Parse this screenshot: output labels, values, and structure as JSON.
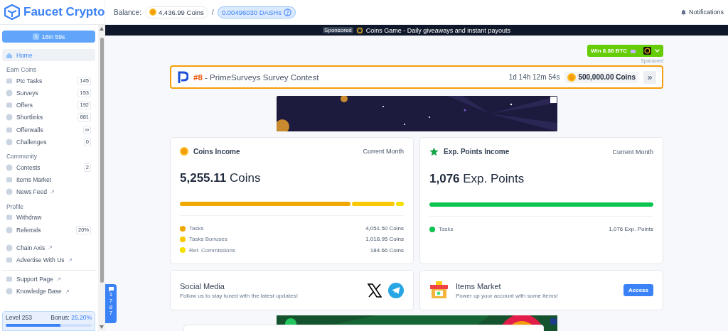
{
  "brand": {
    "name": "Faucet Crypto"
  },
  "header": {
    "balance_label": "Balance:",
    "coins": "4,436.99 Coins",
    "separator": "/",
    "dash": "0.00496030 DASHs",
    "notifications": "Notifications"
  },
  "sidebar": {
    "timer": "18m 59s",
    "sections": [
      {
        "items": [
          {
            "label": "Home",
            "selected": true,
            "external": false
          }
        ]
      },
      {
        "title": "Earn Coins",
        "items": [
          {
            "label": "Ptc Tasks",
            "badge": "145",
            "selected": false,
            "external": false
          },
          {
            "label": "Surveys",
            "badge": "153",
            "selected": false,
            "external": false
          },
          {
            "label": "Offers",
            "badge": "192",
            "selected": false,
            "external": false
          },
          {
            "label": "Shortlinks",
            "badge": "881",
            "selected": false,
            "external": false
          },
          {
            "label": "Offerwalls",
            "badge": "∞",
            "selected": false,
            "external": false
          },
          {
            "label": "Challenges",
            "badge": "0",
            "selected": false,
            "external": false
          }
        ]
      },
      {
        "title": "Community",
        "items": [
          {
            "label": "Contests",
            "badge": "2",
            "selected": false,
            "external": false
          },
          {
            "label": "Items Market",
            "selected": false,
            "external": false
          },
          {
            "label": "News Feed",
            "selected": false,
            "external": true
          }
        ]
      },
      {
        "title": "Profile",
        "items": [
          {
            "label": "Withdraw",
            "selected": false,
            "external": false
          },
          {
            "label": "Referrals",
            "badge": "20%",
            "selected": false,
            "external": false
          }
        ]
      },
      {
        "items": [
          {
            "label": "Chain Axis",
            "selected": false,
            "external": true
          },
          {
            "label": "Advertise With Us",
            "selected": false,
            "external": true
          }
        ],
        "divider_after": true
      },
      {
        "items": [
          {
            "label": "Support Page",
            "selected": false,
            "external": true
          },
          {
            "label": "Knowledge Base",
            "selected": false,
            "external": true
          }
        ]
      }
    ],
    "level": {
      "label": "Level 253",
      "bonus_label": "Bonus:",
      "bonus": "25.20%",
      "level": 0.64
    }
  },
  "chat_button": {
    "count": "1787"
  },
  "sponsor_bar": {
    "tag": "Sponsored",
    "text": "Coins Game - Daily giveaways and instant payouts"
  },
  "promo": {
    "button": "Win 8.88 BTC",
    "note": "Sponsored"
  },
  "contest": {
    "rank": "#8",
    "title": " - PrimeSurveys Survey Contest",
    "countdown": "1d 14h 12m 54s",
    "prize": "500,000.00 Coins",
    "more": "»"
  },
  "income_cards": [
    {
      "kind": "coins",
      "title": "Coins Income",
      "period": "Current Month",
      "amount": "5,255.11",
      "unit": "Coins",
      "breakdown": [
        {
          "label": "Tasks",
          "value": "4,051.50 Coins",
          "color": "#f0a800"
        },
        {
          "label": "Tasks Bonuses",
          "value": "1,018.95 Coins",
          "color": "#fac800"
        },
        {
          "label": "Ref. Commissions",
          "value": "184.66 Coins",
          "color": "#f5e000"
        }
      ]
    },
    {
      "kind": "exp",
      "title": "Exp. Points Income",
      "period": "Current Month",
      "amount": "1,076",
      "unit": "Exp. Points",
      "breakdown": [
        {
          "label": "Tasks",
          "value": "1,076 Exp. Points",
          "color": "#0cc44f"
        }
      ]
    }
  ],
  "info_cards": [
    {
      "kind": "social",
      "title": "Social Media",
      "text": "Follow us to stay tuned with the latest updates!"
    },
    {
      "kind": "market",
      "title": "Items Market",
      "text": "Power up your account with some items!",
      "button": "Access"
    }
  ]
}
